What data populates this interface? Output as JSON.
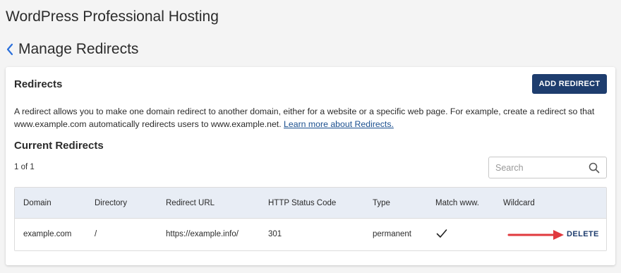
{
  "app": {
    "title": "WordPress Professional Hosting"
  },
  "page": {
    "title": "Manage Redirects"
  },
  "card": {
    "title": "Redirects",
    "add_button": "ADD REDIRECT",
    "description_text": "A redirect allows you to make one domain redirect to another domain, either for a website or a specific web page. For example, create a redirect so that www.example.com automatically redirects users to www.example.net. ",
    "learn_more_link": "Learn more about Redirects.",
    "section_title": "Current Redirects",
    "count": "1 of 1",
    "search": {
      "placeholder": "Search",
      "value": ""
    }
  },
  "table": {
    "headers": [
      "Domain",
      "Directory",
      "Redirect URL",
      "HTTP Status Code",
      "Type",
      "Match www.",
      "Wildcard"
    ],
    "rows": [
      {
        "domain": "example.com",
        "directory": "/",
        "redirect_url": "https://example.info/",
        "status_code": "301",
        "type": "permanent",
        "match_www": true,
        "wildcard": false,
        "action": "DELETE"
      }
    ]
  },
  "icons": {
    "back": "chevron-left-icon",
    "search": "search-icon",
    "match_www": "checkmark-icon",
    "annotation": "red-arrow-icon"
  },
  "colors": {
    "background": "#f4f4f4",
    "primary_button": "#1e3d6e",
    "back_chevron": "#2a6fdb",
    "table_header_bg": "#e8edf5",
    "link": "#1a4f8f",
    "annotation_arrow": "#e0393e"
  }
}
